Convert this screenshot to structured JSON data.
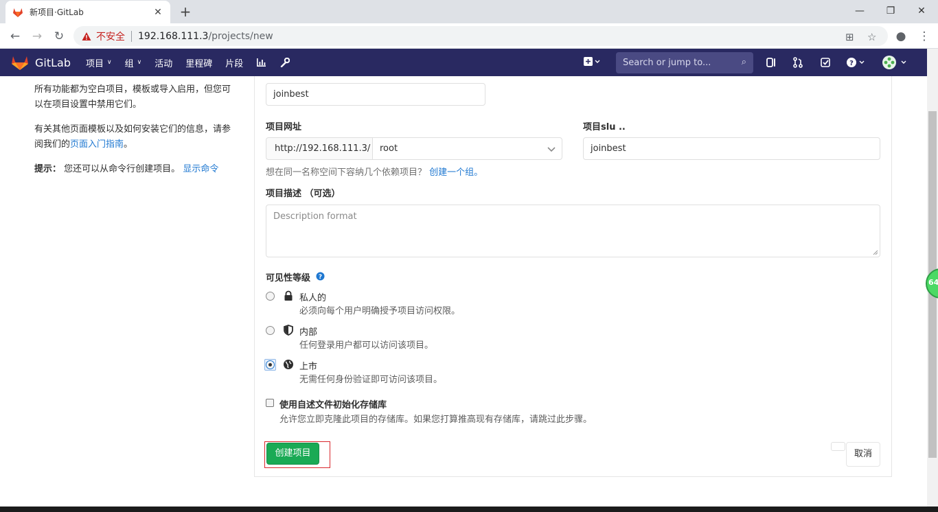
{
  "browser": {
    "tab_title": "新项目·GitLab",
    "insecure_label": "不安全",
    "url_host": "192.168.111.3",
    "url_path": "/projects/new"
  },
  "navbar": {
    "brand": "GitLab",
    "items": [
      "项目",
      "组",
      "活动",
      "里程碑",
      "片段"
    ],
    "search_placeholder": "Search or jump to...",
    "bg_color": "#292961"
  },
  "help": {
    "para1": "所有功能都为空白项目，模板或导入启用，但您可以在项目设置中禁用它们。",
    "para2_prefix": "有关其他页面模板以及如何安装它们的信息，请参阅我们的",
    "para2_link": "页面入门指南",
    "para2_suffix": "。",
    "tip_label": "提示：",
    "tip_text": "您还可以从命令行创建项目。",
    "tip_link": "显示命令"
  },
  "form": {
    "project_name_value": "joinbest",
    "url_label": "项目网址",
    "url_prefix": "http://192.168.111.3/",
    "namespace_value": "root",
    "slug_label": "项目slu ..",
    "slug_value": "joinbest",
    "group_hint": "想在同一名称空间下容纳几个依赖项目？",
    "group_link": "创建一个组。",
    "desc_label": "项目描述 （可选）",
    "desc_placeholder": "Description format",
    "visibility_label": "可见性等级",
    "visibility": [
      {
        "title": "私人的",
        "desc": "必须向每个用户明确授予项目访问权限。",
        "checked": false
      },
      {
        "title": "内部",
        "desc": "任何登录用户都可以访问该项目。",
        "checked": false
      },
      {
        "title": "上市",
        "desc": "无需任何身份验证即可访问该项目。",
        "checked": true
      }
    ],
    "readme_label": "使用自述文件初始化存储库",
    "readme_desc": "允许您立即克隆此项目的存储库。如果您打算推高现有存储库，请跳过此步骤。",
    "create_button": "创建项目",
    "cancel_button": "取消",
    "create_color": "#1aaa55"
  },
  "badge_text": "64"
}
